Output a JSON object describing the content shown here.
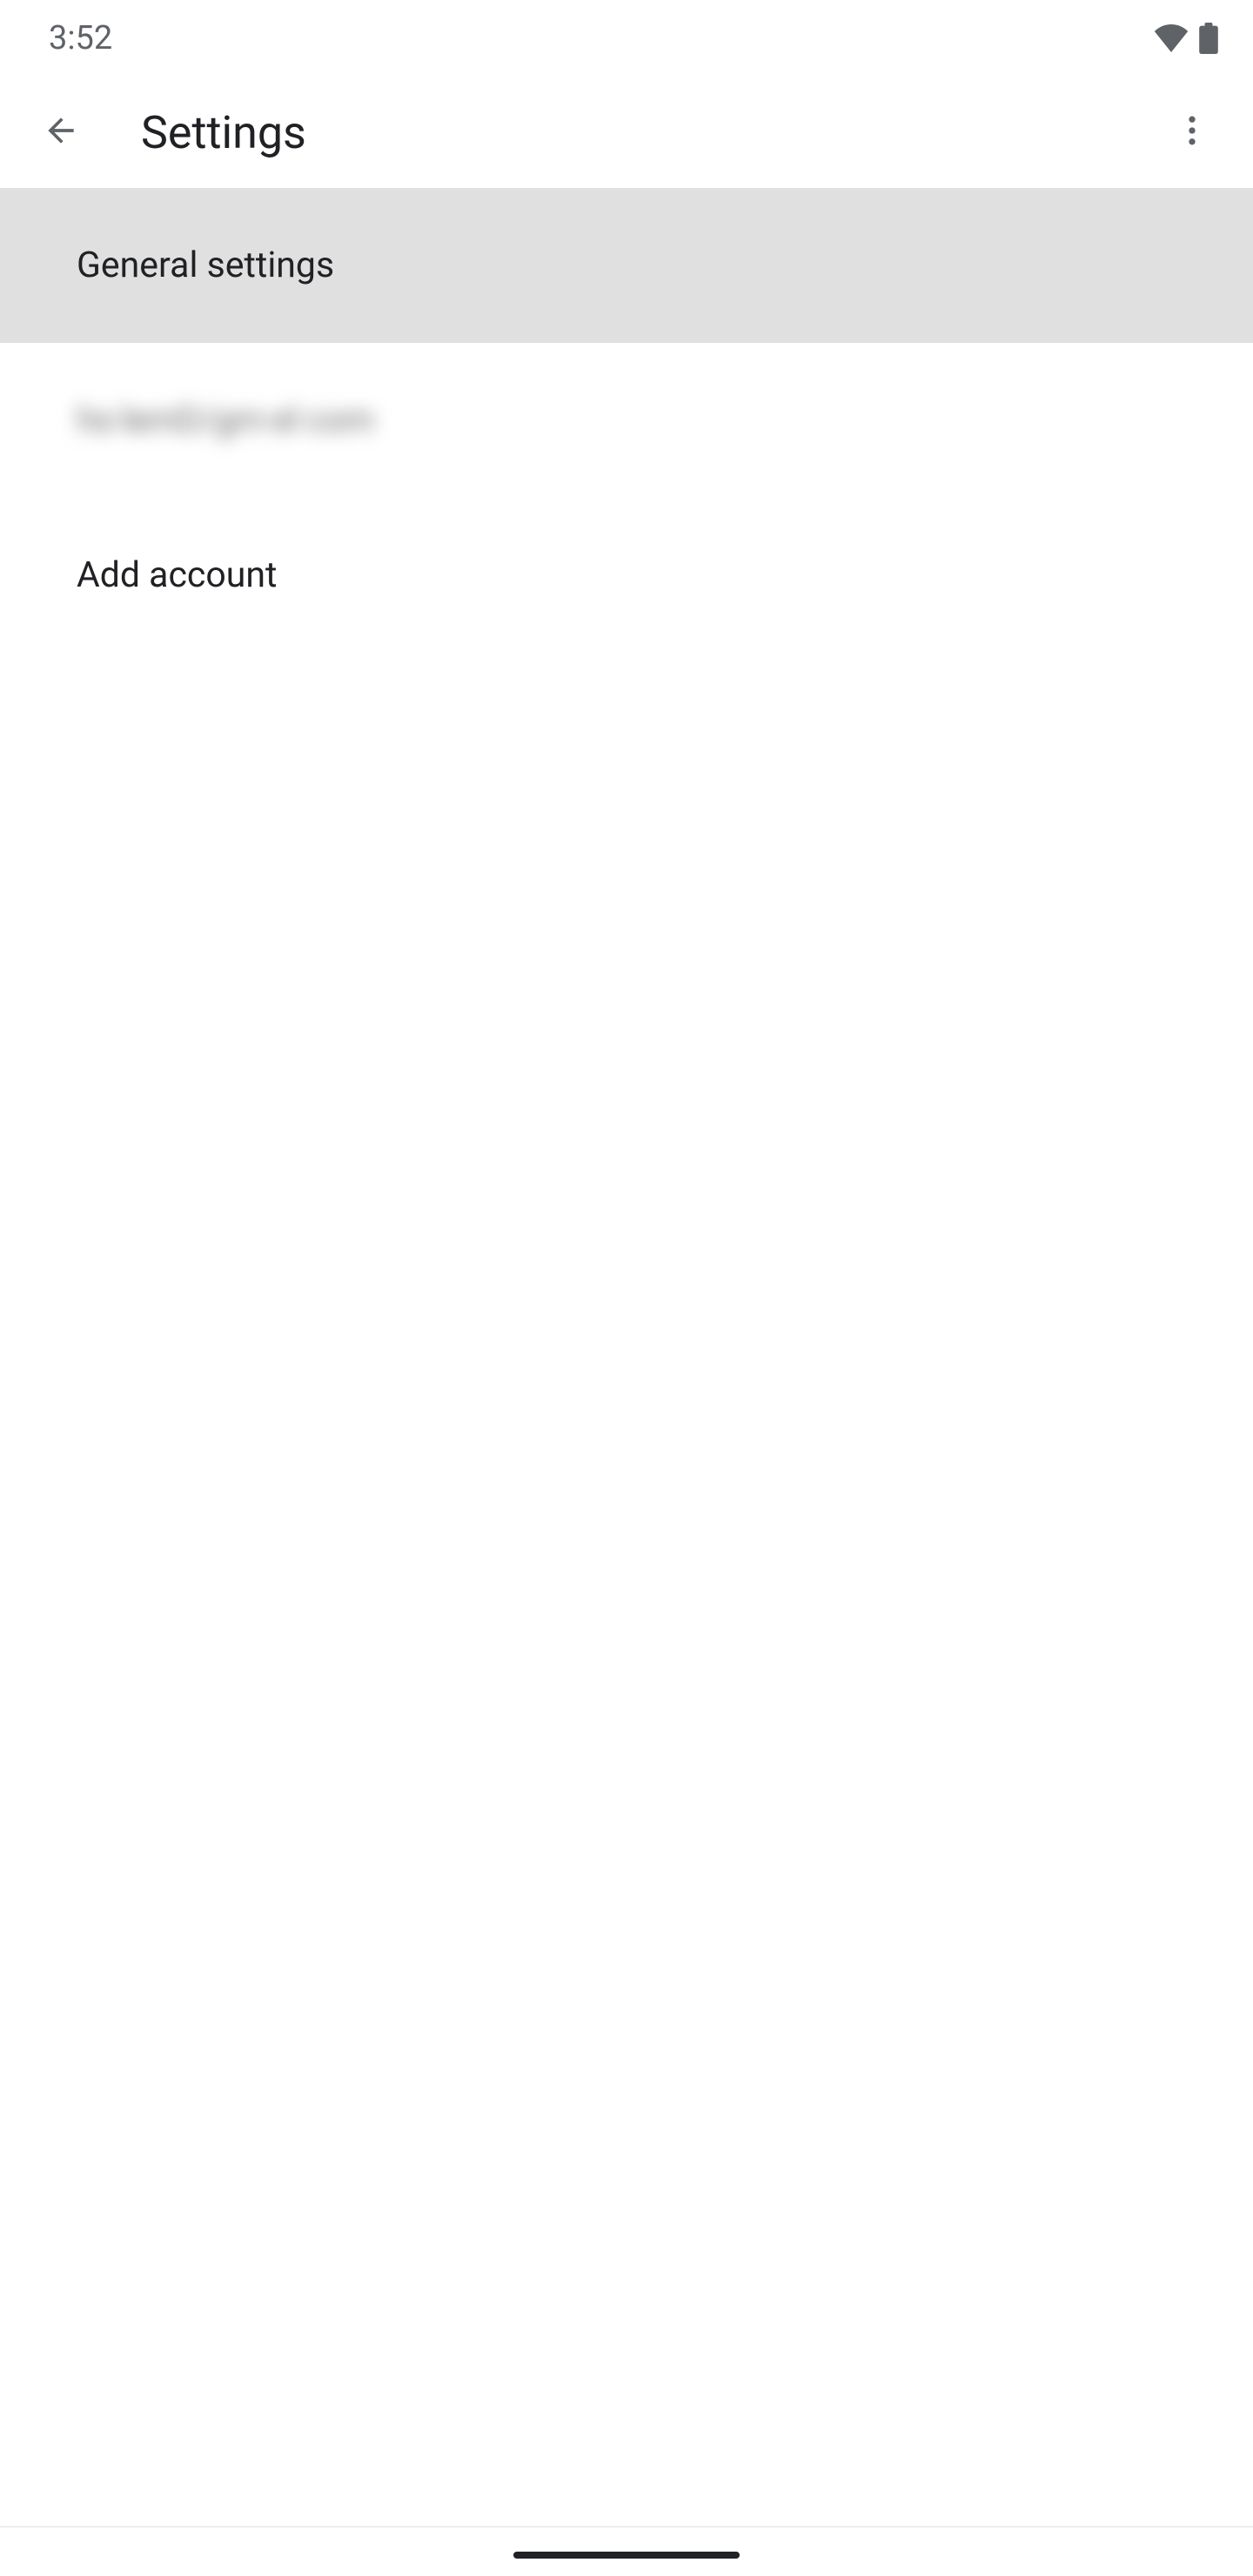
{
  "status_bar": {
    "time": "3:52"
  },
  "app_bar": {
    "title": "Settings"
  },
  "list": {
    "items": [
      {
        "label": "General settings",
        "selected": true
      },
      {
        "label": "hs·lemD/gm·el com",
        "blurred": true
      },
      {
        "label": "Add account"
      }
    ]
  }
}
